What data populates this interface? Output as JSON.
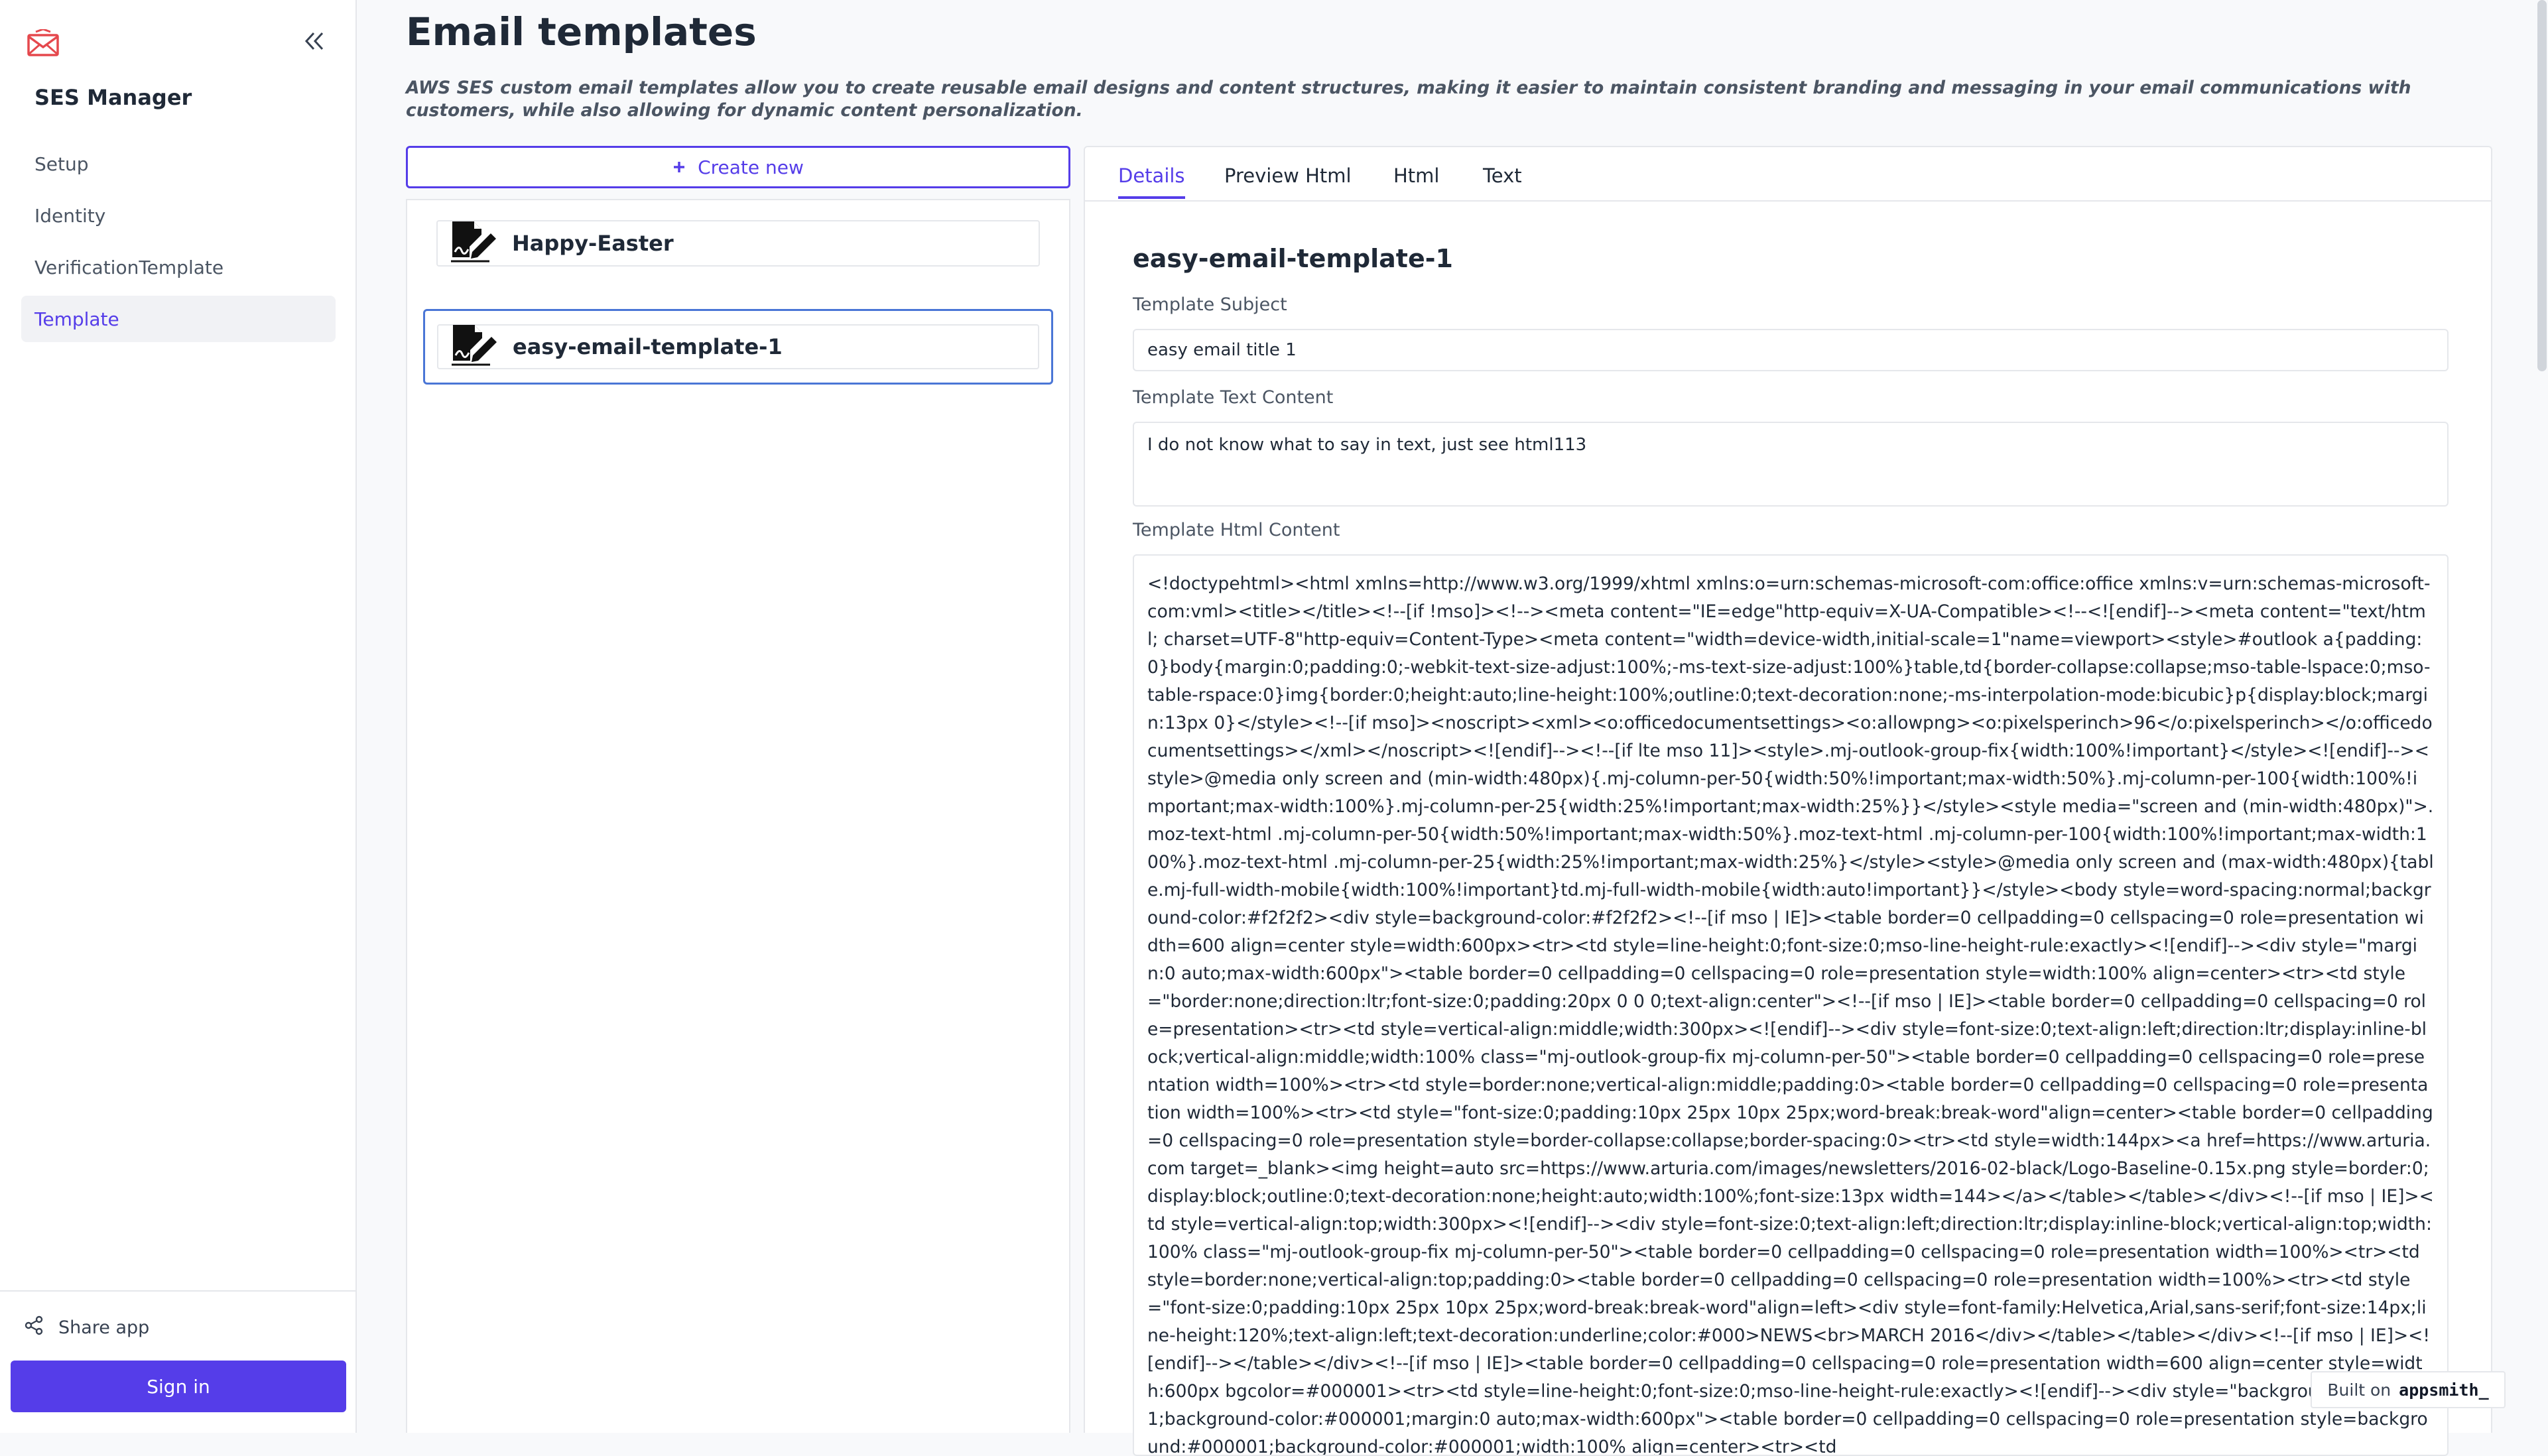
{
  "sidebar": {
    "app_name": "SES Manager",
    "logo_icon": "envelope-icon",
    "items": [
      {
        "label": "Setup"
      },
      {
        "label": "Identity"
      },
      {
        "label": "VerificationTemplate"
      },
      {
        "label": "Template"
      }
    ],
    "active_item": "Template",
    "share_label": "Share app",
    "signin_label": "Sign in"
  },
  "main": {
    "title": "Email templates",
    "description": "AWS SES custom email templates allow you to create reusable email designs and content structures, making it easier to maintain consistent branding and messaging in your email communications with customers, while also allowing for dynamic content personalization.",
    "create_label": "Create new",
    "templates": [
      {
        "name": "Happy-Easter"
      },
      {
        "name": "easy-email-template-1"
      }
    ],
    "selected_template": "easy-email-template-1"
  },
  "details": {
    "tabs": [
      {
        "label": "Details"
      },
      {
        "label": "Preview Html"
      },
      {
        "label": "Html"
      },
      {
        "label": "Text"
      }
    ],
    "active_tab": "Details",
    "template_name": "easy-email-template-1",
    "subject_label": "Template Subject",
    "subject_value": "easy email title 1",
    "text_label": "Template Text Content",
    "text_value": "I do not know what to say in text, just see html113",
    "html_label": "Template Html Content",
    "html_value": "<!doctypehtml><html xmlns=http://www.w3.org/1999/xhtml xmlns:o=urn:schemas-microsoft-com:office:office xmlns:v=urn:schemas-microsoft-com:vml><title></title><!--[if !mso]><!--><meta content=\"IE=edge\"http-equiv=X-UA-Compatible><!--<![endif]--><meta content=\"text/html; charset=UTF-8\"http-equiv=Content-Type><meta content=\"width=device-width,initial-scale=1\"name=viewport><style>#outlook a{padding:0}body{margin:0;padding:0;-webkit-text-size-adjust:100%;-ms-text-size-adjust:100%}table,td{border-collapse:collapse;mso-table-lspace:0;mso-table-rspace:0}img{border:0;height:auto;line-height:100%;outline:0;text-decoration:none;-ms-interpolation-mode:bicubic}p{display:block;margin:13px 0}</style><!--[if mso]><noscript><xml><o:officedocumentsettings><o:allowpng><o:pixelsperinch>96</o:pixelsperinch></o:officedocumentsettings></xml></noscript><![endif]--><!--[if lte mso 11]><style>.mj-outlook-group-fix{width:100%!important}</style><![endif]--><style>@media only screen and (min-width:480px){.mj-column-per-50{width:50%!important;max-width:50%}.mj-column-per-100{width:100%!important;max-width:100%}.mj-column-per-25{width:25%!important;max-width:25%}}</style><style media=\"screen and (min-width:480px)\">.moz-text-html .mj-column-per-50{width:50%!important;max-width:50%}.moz-text-html .mj-column-per-100{width:100%!important;max-width:100%}.moz-text-html .mj-column-per-25{width:25%!important;max-width:25%}</style><style>@media only screen and (max-width:480px){table.mj-full-width-mobile{width:100%!important}td.mj-full-width-mobile{width:auto!important}}</style><body style=word-spacing:normal;background-color:#f2f2f2><div style=background-color:#f2f2f2><!--[if mso | IE]><table border=0 cellpadding=0 cellspacing=0 role=presentation width=600 align=center style=width:600px><tr><td style=line-height:0;font-size:0;mso-line-height-rule:exactly><![endif]--><div style=\"margin:0 auto;max-width:600px\"><table border=0 cellpadding=0 cellspacing=0 role=presentation style=width:100% align=center><tr><td style=\"border:none;direction:ltr;font-size:0;padding:20px 0 0 0;text-align:center\"><!--[if mso | IE]><table border=0 cellpadding=0 cellspacing=0 role=presentation><tr><td style=vertical-align:middle;width:300px><![endif]--><div style=font-size:0;text-align:left;direction:ltr;display:inline-block;vertical-align:middle;width:100% class=\"mj-outlook-group-fix mj-column-per-50\"><table border=0 cellpadding=0 cellspacing=0 role=presentation width=100%><tr><td style=border:none;vertical-align:middle;padding:0><table border=0 cellpadding=0 cellspacing=0 role=presentation width=100%><tr><td style=\"font-size:0;padding:10px 25px 10px 25px;word-break:break-word\"align=center><table border=0 cellpadding=0 cellspacing=0 role=presentation style=border-collapse:collapse;border-spacing:0><tr><td style=width:144px><a href=https://www.arturia.com target=_blank><img height=auto src=https://www.arturia.com/images/newsletters/2016-02-black/Logo-Baseline-0.15x.png style=border:0;display:block;outline:0;text-decoration:none;height:auto;width:100%;font-size:13px width=144></a></table></table></div><!--[if mso | IE]><td style=vertical-align:top;width:300px><![endif]--><div style=font-size:0;text-align:left;direction:ltr;display:inline-block;vertical-align:top;width:100% class=\"mj-outlook-group-fix mj-column-per-50\"><table border=0 cellpadding=0 cellspacing=0 role=presentation width=100%><tr><td style=border:none;vertical-align:top;padding:0><table border=0 cellpadding=0 cellspacing=0 role=presentation width=100%><tr><td style=\"font-size:0;padding:10px 25px 10px 25px;word-break:break-word\"align=left><div style=font-family:Helvetica,Arial,sans-serif;font-size:14px;line-height:120%;text-align:left;text-decoration:underline;color:#000>NEWS<br>MARCH 2016</div></table></table></div><!--[if mso | IE]><![endif]--></table></div><!--[if mso | IE]><table border=0 cellpadding=0 cellspacing=0 role=presentation width=600 align=center style=width:600px bgcolor=#000001><tr><td style=line-height:0;font-size:0;mso-line-height-rule:exactly><![endif]--><div style=\"background:#000001;background-color:#000001;margin:0 auto;max-width:600px\"><table border=0 cellpadding=0 cellspacing=0 role=presentation style=background:#000001;background-color:#000001;width:100% align=center><tr><td"
  },
  "badge": {
    "built_on": "Built on",
    "brand": "appsmith_"
  },
  "colors": {
    "accent": "#553de9",
    "selected_border": "#4a76d6"
  }
}
